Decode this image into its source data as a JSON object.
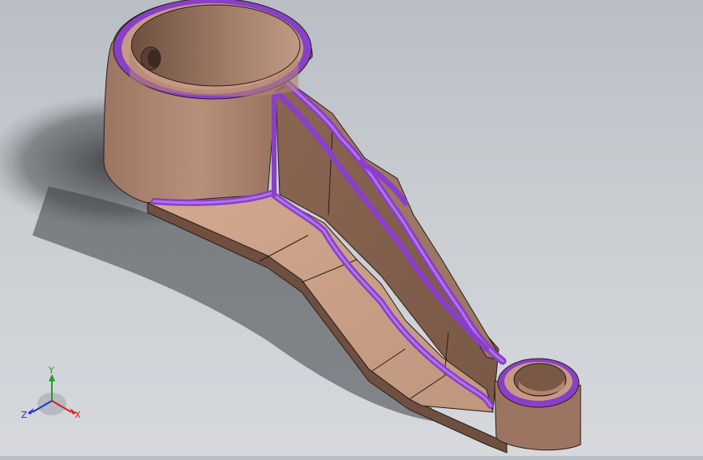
{
  "viewport": {
    "background_top": "#b9bec5",
    "background_bottom": "#d6d8dc"
  },
  "model": {
    "body_color": "#b08670",
    "body_shade": "#8f6a58",
    "body_light": "#c59a84",
    "fillet_color": "#8a3fc8",
    "fillet_light": "#a868e0",
    "edge_color": "#2a1e18"
  },
  "triad": {
    "x_label": "X",
    "y_label": "Y",
    "z_label": "Z",
    "x_color": "#d22020",
    "y_color": "#22a022",
    "z_color": "#2030d0"
  }
}
